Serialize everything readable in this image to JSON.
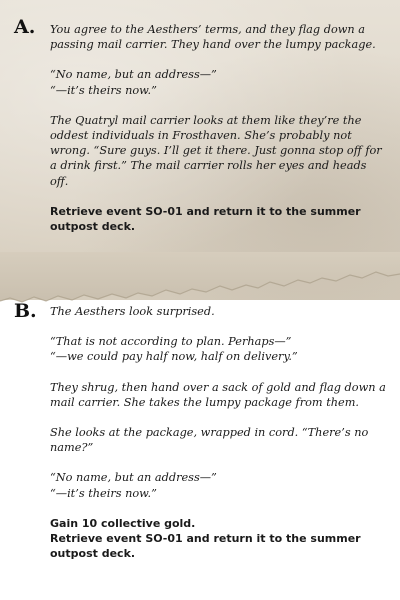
{
  "colors": {
    "parchment": "#ddd5c7",
    "page": "#ffffff",
    "text": "#1a1a1a"
  },
  "section_a": {
    "marker": "A.",
    "intro": "You agree to the Aesthers’ terms, and they flag down a passing mail carrier. They hand over the lumpy package.",
    "dialogue": [
      "“No name, but an address—”",
      "“—it’s theirs now.”"
    ],
    "narrative": "The Quatryl mail carrier looks at them like they’re the oddest individuals in Frosthaven. She’s probably not wrong. “Sure guys. I’ll get it there. Just gonna stop off for a drink first.” The mail carrier rolls her eyes and heads off.",
    "outcome": "Retrieve event SO-01 and return it to the summer outpost deck."
  },
  "section_b": {
    "marker": "B.",
    "intro": "The Aesthers look surprised.",
    "dialogue_1": [
      "“That is not according to plan. Perhaps—”",
      "“—we could pay half now, half on delivery.”"
    ],
    "para_1": "They shrug, then hand over a sack of gold and flag down a mail carrier. She takes the lumpy package from them.",
    "para_2": "She looks at the package, wrapped in cord. “There’s no name?”",
    "dialogue_2": [
      "“No name, but an address—”",
      "“—it’s theirs now.”"
    ],
    "outcomes": [
      "Gain 10 collective gold.",
      "Retrieve event SO-01 and return it to the summer outpost deck."
    ]
  }
}
